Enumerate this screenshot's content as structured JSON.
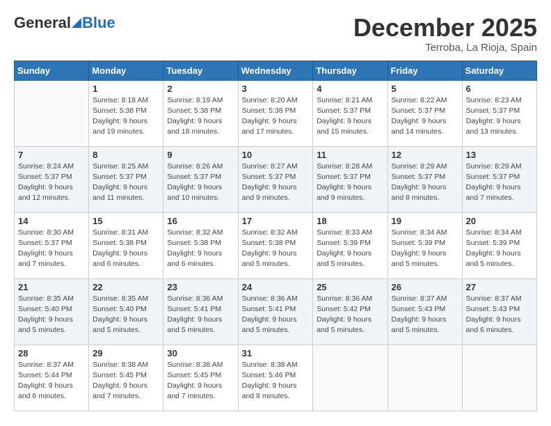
{
  "logo": {
    "general": "General",
    "blue": "Blue"
  },
  "title": "December 2025",
  "location": "Terroba, La Rioja, Spain",
  "days_of_week": [
    "Sunday",
    "Monday",
    "Tuesday",
    "Wednesday",
    "Thursday",
    "Friday",
    "Saturday"
  ],
  "weeks": [
    [
      {
        "day": "",
        "sunrise": "",
        "sunset": "",
        "daylight": ""
      },
      {
        "day": "1",
        "sunrise": "Sunrise: 8:18 AM",
        "sunset": "Sunset: 5:38 PM",
        "daylight": "Daylight: 9 hours and 19 minutes."
      },
      {
        "day": "2",
        "sunrise": "Sunrise: 8:19 AM",
        "sunset": "Sunset: 5:38 PM",
        "daylight": "Daylight: 9 hours and 18 minutes."
      },
      {
        "day": "3",
        "sunrise": "Sunrise: 8:20 AM",
        "sunset": "Sunset: 5:38 PM",
        "daylight": "Daylight: 9 hours and 17 minutes."
      },
      {
        "day": "4",
        "sunrise": "Sunrise: 8:21 AM",
        "sunset": "Sunset: 5:37 PM",
        "daylight": "Daylight: 9 hours and 15 minutes."
      },
      {
        "day": "5",
        "sunrise": "Sunrise: 8:22 AM",
        "sunset": "Sunset: 5:37 PM",
        "daylight": "Daylight: 9 hours and 14 minutes."
      },
      {
        "day": "6",
        "sunrise": "Sunrise: 8:23 AM",
        "sunset": "Sunset: 5:37 PM",
        "daylight": "Daylight: 9 hours and 13 minutes."
      }
    ],
    [
      {
        "day": "7",
        "sunrise": "Sunrise: 8:24 AM",
        "sunset": "Sunset: 5:37 PM",
        "daylight": "Daylight: 9 hours and 12 minutes."
      },
      {
        "day": "8",
        "sunrise": "Sunrise: 8:25 AM",
        "sunset": "Sunset: 5:37 PM",
        "daylight": "Daylight: 9 hours and 11 minutes."
      },
      {
        "day": "9",
        "sunrise": "Sunrise: 8:26 AM",
        "sunset": "Sunset: 5:37 PM",
        "daylight": "Daylight: 9 hours and 10 minutes."
      },
      {
        "day": "10",
        "sunrise": "Sunrise: 8:27 AM",
        "sunset": "Sunset: 5:37 PM",
        "daylight": "Daylight: 9 hours and 9 minutes."
      },
      {
        "day": "11",
        "sunrise": "Sunrise: 8:28 AM",
        "sunset": "Sunset: 5:37 PM",
        "daylight": "Daylight: 9 hours and 9 minutes."
      },
      {
        "day": "12",
        "sunrise": "Sunrise: 8:29 AM",
        "sunset": "Sunset: 5:37 PM",
        "daylight": "Daylight: 9 hours and 8 minutes."
      },
      {
        "day": "13",
        "sunrise": "Sunrise: 8:29 AM",
        "sunset": "Sunset: 5:37 PM",
        "daylight": "Daylight: 9 hours and 7 minutes."
      }
    ],
    [
      {
        "day": "14",
        "sunrise": "Sunrise: 8:30 AM",
        "sunset": "Sunset: 5:37 PM",
        "daylight": "Daylight: 9 hours and 7 minutes."
      },
      {
        "day": "15",
        "sunrise": "Sunrise: 8:31 AM",
        "sunset": "Sunset: 5:38 PM",
        "daylight": "Daylight: 9 hours and 6 minutes."
      },
      {
        "day": "16",
        "sunrise": "Sunrise: 8:32 AM",
        "sunset": "Sunset: 5:38 PM",
        "daylight": "Daylight: 9 hours and 6 minutes."
      },
      {
        "day": "17",
        "sunrise": "Sunrise: 8:32 AM",
        "sunset": "Sunset: 5:38 PM",
        "daylight": "Daylight: 9 hours and 5 minutes."
      },
      {
        "day": "18",
        "sunrise": "Sunrise: 8:33 AM",
        "sunset": "Sunset: 5:39 PM",
        "daylight": "Daylight: 9 hours and 5 minutes."
      },
      {
        "day": "19",
        "sunrise": "Sunrise: 8:34 AM",
        "sunset": "Sunset: 5:39 PM",
        "daylight": "Daylight: 9 hours and 5 minutes."
      },
      {
        "day": "20",
        "sunrise": "Sunrise: 8:34 AM",
        "sunset": "Sunset: 5:39 PM",
        "daylight": "Daylight: 9 hours and 5 minutes."
      }
    ],
    [
      {
        "day": "21",
        "sunrise": "Sunrise: 8:35 AM",
        "sunset": "Sunset: 5:40 PM",
        "daylight": "Daylight: 9 hours and 5 minutes."
      },
      {
        "day": "22",
        "sunrise": "Sunrise: 8:35 AM",
        "sunset": "Sunset: 5:40 PM",
        "daylight": "Daylight: 9 hours and 5 minutes."
      },
      {
        "day": "23",
        "sunrise": "Sunrise: 8:36 AM",
        "sunset": "Sunset: 5:41 PM",
        "daylight": "Daylight: 9 hours and 5 minutes."
      },
      {
        "day": "24",
        "sunrise": "Sunrise: 8:36 AM",
        "sunset": "Sunset: 5:41 PM",
        "daylight": "Daylight: 9 hours and 5 minutes."
      },
      {
        "day": "25",
        "sunrise": "Sunrise: 8:36 AM",
        "sunset": "Sunset: 5:42 PM",
        "daylight": "Daylight: 9 hours and 5 minutes."
      },
      {
        "day": "26",
        "sunrise": "Sunrise: 8:37 AM",
        "sunset": "Sunset: 5:43 PM",
        "daylight": "Daylight: 9 hours and 5 minutes."
      },
      {
        "day": "27",
        "sunrise": "Sunrise: 8:37 AM",
        "sunset": "Sunset: 5:43 PM",
        "daylight": "Daylight: 9 hours and 6 minutes."
      }
    ],
    [
      {
        "day": "28",
        "sunrise": "Sunrise: 8:37 AM",
        "sunset": "Sunset: 5:44 PM",
        "daylight": "Daylight: 9 hours and 6 minutes."
      },
      {
        "day": "29",
        "sunrise": "Sunrise: 8:38 AM",
        "sunset": "Sunset: 5:45 PM",
        "daylight": "Daylight: 9 hours and 7 minutes."
      },
      {
        "day": "30",
        "sunrise": "Sunrise: 8:38 AM",
        "sunset": "Sunset: 5:45 PM",
        "daylight": "Daylight: 9 hours and 7 minutes."
      },
      {
        "day": "31",
        "sunrise": "Sunrise: 8:38 AM",
        "sunset": "Sunset: 5:46 PM",
        "daylight": "Daylight: 9 hours and 8 minutes."
      },
      {
        "day": "",
        "sunrise": "",
        "sunset": "",
        "daylight": ""
      },
      {
        "day": "",
        "sunrise": "",
        "sunset": "",
        "daylight": ""
      },
      {
        "day": "",
        "sunrise": "",
        "sunset": "",
        "daylight": ""
      }
    ]
  ]
}
